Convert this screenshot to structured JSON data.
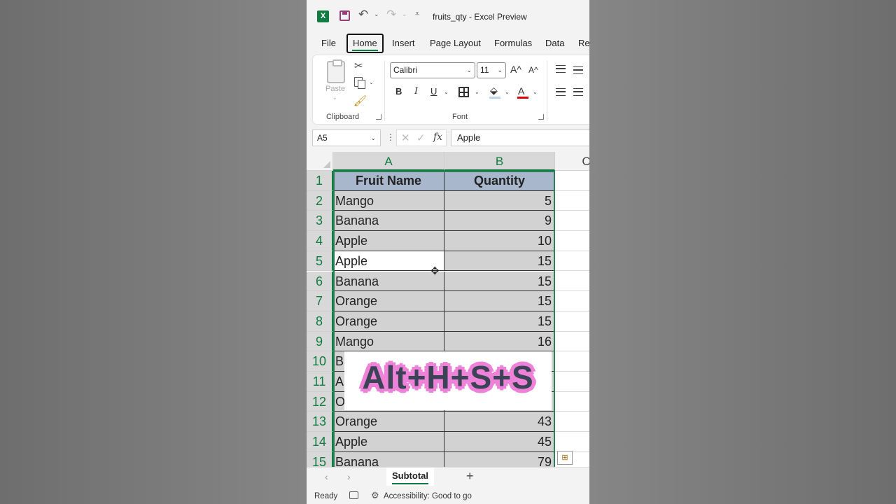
{
  "titlebar": {
    "app_icon": "X",
    "doc_title": "fruits_qty  -  Excel Preview"
  },
  "tabs": [
    "File",
    "Home",
    "Insert",
    "Page Layout",
    "Formulas",
    "Data",
    "Re"
  ],
  "active_tab": "Home",
  "ribbon": {
    "paste_label": "Paste",
    "clipboard_label": "Clipboard",
    "font_label": "Font",
    "font_name": "Calibri",
    "font_size": "11",
    "grow": "A^",
    "shrink": "A^",
    "bold": "B",
    "italic": "I",
    "underline": "U",
    "font_color_glyph": "A"
  },
  "formula_bar": {
    "name_box": "A5",
    "fx": "fx",
    "formula": "Apple"
  },
  "columns": [
    "A",
    "B",
    "C"
  ],
  "rows": [
    {
      "n": "1",
      "a": "Fruit Name",
      "b": "Quantity"
    },
    {
      "n": "2",
      "a": "Mango",
      "b": "5"
    },
    {
      "n": "3",
      "a": "Banana",
      "b": "9"
    },
    {
      "n": "4",
      "a": "Apple",
      "b": "10"
    },
    {
      "n": "5",
      "a": "Apple",
      "b": "15"
    },
    {
      "n": "6",
      "a": "Banana",
      "b": "15"
    },
    {
      "n": "7",
      "a": "Orange",
      "b": "15"
    },
    {
      "n": "8",
      "a": "Orange",
      "b": "15"
    },
    {
      "n": "9",
      "a": "Mango",
      "b": "16"
    },
    {
      "n": "10",
      "a": "Ba",
      "b": ""
    },
    {
      "n": "11",
      "a": "A",
      "b": ""
    },
    {
      "n": "12",
      "a": "O",
      "b": ""
    },
    {
      "n": "13",
      "a": "Orange",
      "b": "43"
    },
    {
      "n": "14",
      "a": "Apple",
      "b": "45"
    },
    {
      "n": "15",
      "a": "Banana",
      "b": "79"
    }
  ],
  "overlay": {
    "text": "Alt+H+S+S"
  },
  "sheets": {
    "active": "Subtotal",
    "add": "+"
  },
  "status": {
    "ready": "Ready",
    "accessibility": "Accessibility: Good to go"
  },
  "colors": {
    "accent": "#107c41",
    "header_fill": "#a9b7cc",
    "overlay_outline": "#ee82d8"
  }
}
